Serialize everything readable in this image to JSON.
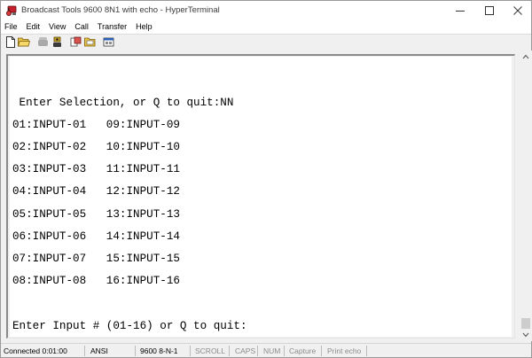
{
  "window": {
    "title": "Broadcast Tools 9600 8N1 with echo - HyperTerminal"
  },
  "menu": {
    "items": [
      "File",
      "Edit",
      "View",
      "Call",
      "Transfer",
      "Help"
    ]
  },
  "toolbar": {
    "buttons": [
      "new-connection",
      "open",
      "disconnect",
      "dial",
      "send",
      "receive",
      "properties"
    ]
  },
  "terminal": {
    "prompt_selection": " Enter Selection, or Q to quit:NN",
    "rows": [
      "01:INPUT-01   09:INPUT-09",
      "02:INPUT-02   10:INPUT-10",
      "03:INPUT-03   11:INPUT-11",
      "04:INPUT-04   12:INPUT-12",
      "05:INPUT-05   13:INPUT-13",
      "06:INPUT-06   14:INPUT-14",
      "07:INPUT-07   15:INPUT-15",
      "08:INPUT-08   16:INPUT-16"
    ],
    "prompt_input": "Enter Input # (01-16) or Q to quit:"
  },
  "status": {
    "connected": "Connected 0:01:00",
    "emulation": "ANSI",
    "settings": "9600 8-N-1",
    "scroll": "SCROLL",
    "caps": "CAPS",
    "num": "NUM",
    "capture": "Capture",
    "print_echo": "Print echo"
  },
  "colors": {
    "terminal_bg": "#ffffff",
    "window_bg": "#f0f0f0",
    "dim_text": "#8c8c8c"
  }
}
